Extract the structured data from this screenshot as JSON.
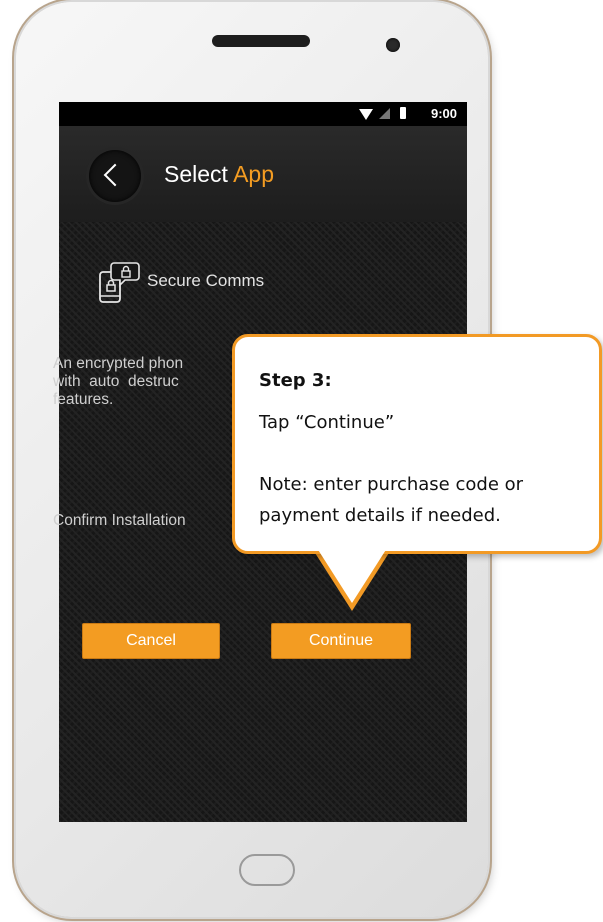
{
  "status_bar": {
    "time": "9:00"
  },
  "header": {
    "title_part1": "Select",
    "title_part2": "App"
  },
  "app": {
    "name": "Secure Comms",
    "description": "An encrypted phone with auto destruct features.",
    "desc_visible_line1": "An encrypted phon",
    "desc_visible_line2": "with  auto  destruc",
    "desc_visible_line3": "features.",
    "confirm_text": "Confirm Installation"
  },
  "buttons": {
    "cancel": "Cancel",
    "continue": "Continue"
  },
  "callout": {
    "step": "Step 3:",
    "instruction": "Tap “Continue”",
    "note_line1": "Note: enter purchase code or",
    "note_line2": "payment details if needed."
  },
  "colors": {
    "accent": "#f39c22",
    "callout_border": "#f29a25"
  },
  "icons": {
    "back": "chevron-left-icon",
    "app": "secure-phone-chat-icon"
  }
}
